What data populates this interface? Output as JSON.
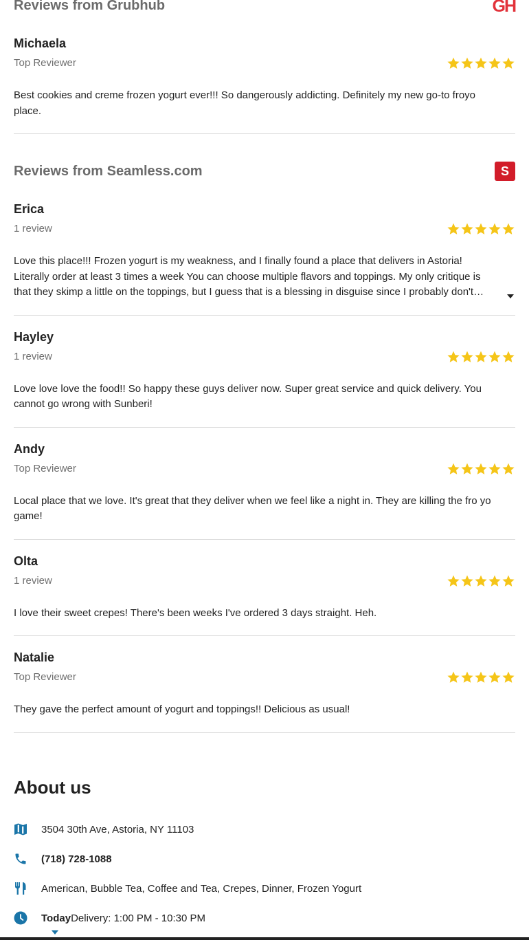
{
  "colors": {
    "star": "#f5c518",
    "icon": "#1a75a8",
    "grubhub": "#e2323a",
    "seamless": "#d21d2a"
  },
  "grubhub": {
    "title": "Reviews from Grubhub",
    "logo": "GH",
    "reviews": [
      {
        "name": "Michaela",
        "meta": "Top Reviewer",
        "rating": 5,
        "text": "Best cookies and creme frozen yogurt ever!!! So dangerously addicting. Definitely my new go-to froyo place."
      }
    ]
  },
  "seamless": {
    "title": "Reviews from Seamless.com",
    "logo": "S",
    "reviews": [
      {
        "name": "Erica",
        "meta": "1 review",
        "rating": 5,
        "text": "Love this place!!! Frozen yogurt is my weakness, and I finally found a place that delivers in Astoria! Literally order at least 3 times a week You can choose multiple flavors and toppings. My only critique is that they skimp a little on the toppings, but I guess that is a blessing in disguise since I probably don't need any more toppings anyway."
      },
      {
        "name": "Hayley",
        "meta": "1 review",
        "rating": 5,
        "text": "Love love love the food!! So happy these guys deliver now. Super great service and quick delivery. You cannot go wrong with Sunberi!"
      },
      {
        "name": "Andy",
        "meta": "Top Reviewer",
        "rating": 5,
        "text": "Local place that we love. It's great that they deliver when we feel like a night in. They are killing the fro yo game!"
      },
      {
        "name": "Olta",
        "meta": "1 review",
        "rating": 5,
        "text": "I love their sweet crepes! There's been weeks I've ordered 3 days straight. Heh."
      },
      {
        "name": "Natalie",
        "meta": "Top Reviewer",
        "rating": 5,
        "text": "They gave the perfect amount of yogurt and toppings!! Delicious as usual!"
      }
    ]
  },
  "about": {
    "title": "About us",
    "address": "3504 30th Ave, Astoria, NY 11103",
    "phone": "(718) 728-1088",
    "cuisines": "American, Bubble Tea, Coffee and Tea, Crepes, Dinner, Frozen Yogurt",
    "hours_day": "Today",
    "hours_text": "Delivery: 1:00 PM - 10:30 PM"
  }
}
